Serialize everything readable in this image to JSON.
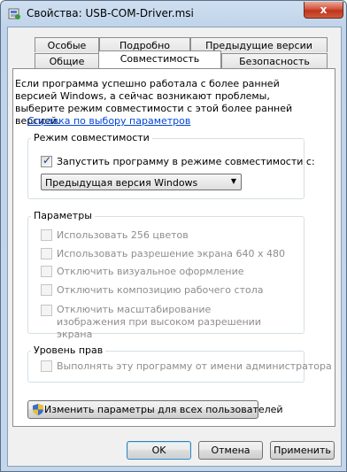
{
  "window": {
    "title": "Свойства: USB-COM-Driver.msi",
    "close_glyph": "x"
  },
  "tabs": {
    "row1": [
      "Особые",
      "Подробно",
      "Предыдущие версии"
    ],
    "row2": [
      "Общие",
      "Совместимость",
      "Безопасность"
    ],
    "active": "Совместимость"
  },
  "intro_text": "Если программа успешно работала с более ранней версией Windows, а сейчас возникают проблемы, выберите режим совместимости с этой более ранней версией.",
  "help_link": "Справка по выбору параметров",
  "compat_group": {
    "label": "Режим совместимости",
    "checkbox_label": "Запустить программу в режиме совместимости с:",
    "checked": true,
    "os_select": "Предыдущая версия Windows"
  },
  "params_group": {
    "label": "Параметры",
    "options": [
      "Использовать 256 цветов",
      "Использовать разрешение экрана 640 x 480",
      "Отключить визуальное оформление",
      "Отключить композицию рабочего стола",
      "Отключить масштабирование изображения при высоком разрешении экрана"
    ]
  },
  "privilege_group": {
    "label": "Уровень прав",
    "option": "Выполнять эту программу от имени администратора"
  },
  "all_users_button": "Изменить параметры для всех пользователей",
  "buttons": {
    "ok": "OK",
    "cancel": "Отмена",
    "apply": "Применить"
  },
  "colors": {
    "link": "#0046d5",
    "disabled_text": "#8d8d8d"
  }
}
